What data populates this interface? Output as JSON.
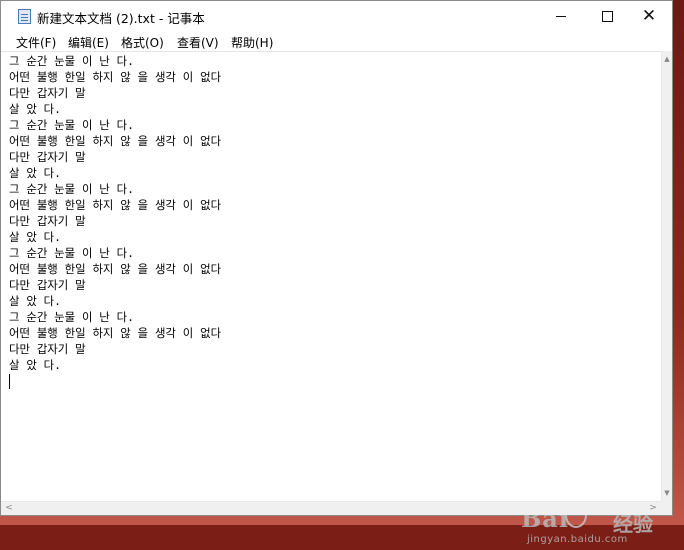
{
  "window": {
    "title": "新建文本文档 (2).txt - 记事本",
    "app_icon": "notepad-icon"
  },
  "caption_buttons": {
    "minimize_icon": "minimize-icon",
    "maximize_icon": "maximize-icon",
    "close_icon": "close-icon",
    "close_glyph": "✕"
  },
  "menu": {
    "file": "文件(F)",
    "edit": "编辑(E)",
    "format": "格式(O)",
    "view": "查看(V)",
    "help": "帮助(H)"
  },
  "editor": {
    "content": "그 순간 눈물 이 난 다.\n어떤 불행 한일 하지 않 을 생각 이 없다\n다만 갑자기 말\n살 았 다.\n그 순간 눈물 이 난 다.\n어떤 불행 한일 하지 않 을 생각 이 없다\n다만 갑자기 말\n살 았 다.\n그 순간 눈물 이 난 다.\n어떤 불행 한일 하지 않 을 생각 이 없다\n다만 갑자기 말\n살 았 다.\n그 순간 눈물 이 난 다.\n어떤 불행 한일 하지 않 을 생각 이 없다\n다만 갑자기 말\n살 았 다.\n그 순간 눈물 이 난 다.\n어떤 불행 한일 하지 않 을 생각 이 없다\n다만 갑자기 말\n살 았 다."
  },
  "scrollbars": {
    "up_arrow": "▲",
    "down_arrow": "▼",
    "left_arrow": "<",
    "right_arrow": ">"
  },
  "watermark": {
    "logo_text": "Bai",
    "jingyan_text": "经验",
    "url_text": "jingyan.baidu.com"
  }
}
